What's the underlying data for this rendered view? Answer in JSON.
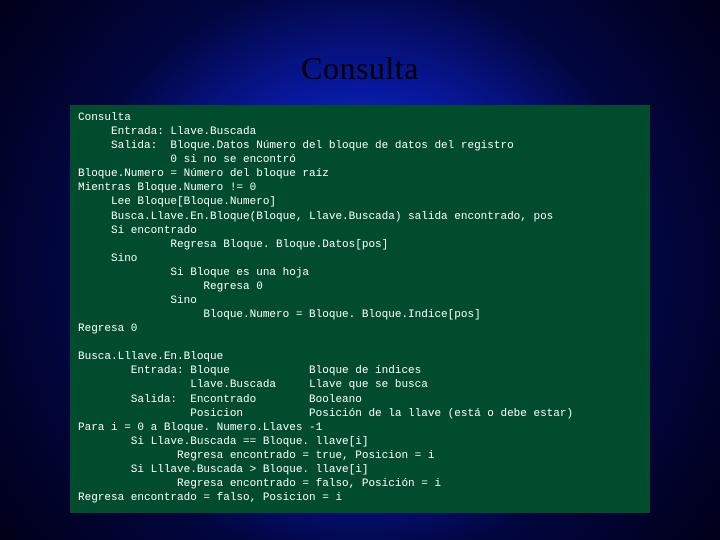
{
  "slide": {
    "title": "Consulta",
    "code": "Consulta\n     Entrada: Llave.Buscada\n     Salida:  Bloque.Datos Número del bloque de datos del registro\n              0 si no se encontró\nBloque.Numero = Número del bloque raíz\nMientras Bloque.Numero != 0\n     Lee Bloque[Bloque.Numero]\n     Busca.Llave.En.Bloque(Bloque, Llave.Buscada) salida encontrado, pos\n     Si encontrado\n              Regresa Bloque. Bloque.Datos[pos]\n     Sino\n              Si Bloque es una hoja\n                   Regresa 0\n              Sino\n                   Bloque.Numero = Bloque. Bloque.Indice[pos]\nRegresa 0\n\nBusca.Lllave.En.Bloque\n        Entrada: Bloque            Bloque de índices\n                 Llave.Buscada     Llave que se busca\n        Salida:  Encontrado        Booleano\n                 Posicion          Posición de la llave (está o debe estar)\nPara i = 0 a Bloque. Numero.Llaves -1\n        Si Llave.Buscada == Bloque. llave[i]\n               Regresa encontrado = true, Posicion = i\n        Si Lllave.Buscada > Bloque. llave[i]\n               Regresa encontrado = falso, Posición = i\nRegresa encontrado = falso, Posicion = i"
  }
}
